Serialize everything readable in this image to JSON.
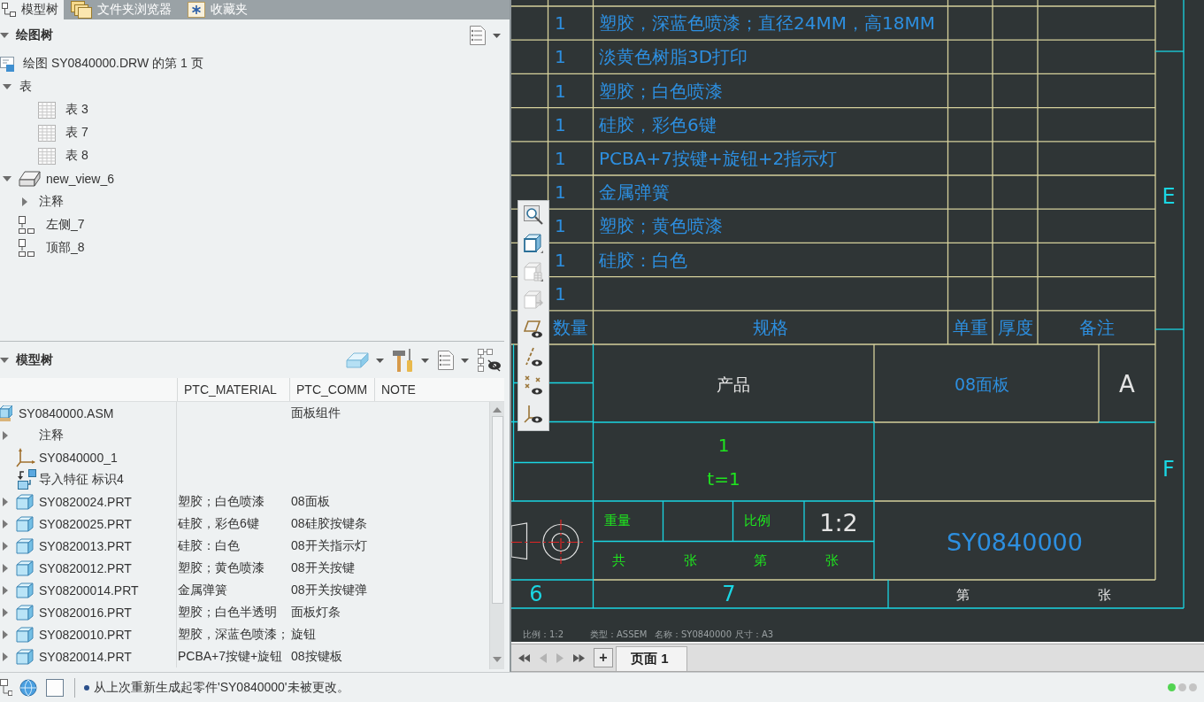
{
  "left_panel": {
    "tabs": [
      {
        "kind": "tree",
        "label": "模型树",
        "selected": true
      },
      {
        "kind": "folders",
        "label": "文件夹浏览器",
        "selected": false
      },
      {
        "kind": "favorites",
        "label": "收藏夹",
        "selected": false
      }
    ],
    "drawing_tree": {
      "title": "绘图树",
      "expanded": true,
      "items": [
        {
          "kind": "sheet",
          "label": "绘图 SY0840000.DRW 的第 1 页"
        },
        {
          "kind": "group",
          "label": "表",
          "expanded": true,
          "children": [
            {
              "kind": "table",
              "label": "表 3"
            },
            {
              "kind": "table",
              "label": "表 7"
            },
            {
              "kind": "table",
              "label": "表 8"
            }
          ]
        },
        {
          "kind": "view",
          "label": "new_view_6",
          "expanded": true,
          "children": [
            {
              "kind": "group",
              "label": "注释",
              "expanded": false
            }
          ]
        },
        {
          "kind": "projection_view",
          "label": "左侧_7"
        },
        {
          "kind": "projection_view",
          "label": "顶部_8"
        }
      ]
    },
    "model_tree": {
      "title": "模型树",
      "expanded": true,
      "columns": [
        "PTC_MATERIAL",
        "PTC_COMM",
        "NOTE"
      ],
      "root": {
        "kind": "assembly",
        "label": "SY0840000.ASM",
        "ptc_comm": "面板组件",
        "children": [
          {
            "kind": "group",
            "label": "注释",
            "expanded": false
          },
          {
            "kind": "csys",
            "label": "SY0840000_1"
          },
          {
            "kind": "import",
            "label": "导入特征 标识4"
          },
          {
            "kind": "part",
            "label": "SY0820024.PRT",
            "expanded": false,
            "ptc_material": "塑胶；白色喷漆",
            "ptc_comm": "08面板"
          },
          {
            "kind": "part",
            "label": "SY0820025.PRT",
            "expanded": false,
            "ptc_material": "硅胶，彩色6键",
            "ptc_comm": "08硅胶按键条"
          },
          {
            "kind": "part",
            "label": "SY0820013.PRT",
            "expanded": false,
            "ptc_material": "硅胶：白色",
            "ptc_comm": "08开关指示灯"
          },
          {
            "kind": "part",
            "label": "SY0820012.PRT",
            "expanded": false,
            "ptc_material": "塑胶；黄色喷漆",
            "ptc_comm": "08开关按键"
          },
          {
            "kind": "part",
            "label": "SY08200014.PRT",
            "expanded": false,
            "ptc_material": "金属弹簧",
            "ptc_comm": "08开关按键弹"
          },
          {
            "kind": "part",
            "label": "SY0820016.PRT",
            "expanded": false,
            "ptc_material": "塑胶；白色半透明",
            "ptc_comm": "面板灯条"
          },
          {
            "kind": "part",
            "label": "SY0820010.PRT",
            "expanded": false,
            "ptc_material": "塑胶，深蓝色喷漆；",
            "ptc_comm": "旋钮"
          },
          {
            "kind": "part",
            "label": "SY0820014.PRT",
            "expanded": false,
            "ptc_material": "PCBA+7按键+旋钮",
            "ptc_comm": "08按键板"
          }
        ]
      }
    }
  },
  "drawing": {
    "parts_list": {
      "columns": [
        "数量",
        "规格",
        "单重",
        "厚度",
        "备注"
      ],
      "rows": [
        {
          "qty": "1",
          "spec": "塑胶，深蓝色喷漆；直径24MM，高18MM"
        },
        {
          "qty": "1",
          "spec": "淡黄色树脂3D打印"
        },
        {
          "qty": "1",
          "spec": "塑胶；白色喷漆"
        },
        {
          "qty": "1",
          "spec": "硅胶，彩色6键"
        },
        {
          "qty": "1",
          "spec": "PCBA+7按键+旋钮+2指示灯"
        },
        {
          "qty": "1",
          "spec": "金属弹簧"
        },
        {
          "qty": "1",
          "spec": "塑胶；黄色喷漆"
        },
        {
          "qty": "1",
          "spec": "硅胶：白色"
        },
        {
          "qty": "1"
        }
      ]
    },
    "title_block": {
      "product": "产品",
      "part_name": "08面板",
      "revision": "A",
      "notes": [
        "1",
        "t=1"
      ],
      "weight_label": "重量",
      "scale_label": "比例",
      "scale": "1:2",
      "sheet_count": [
        "共",
        "张",
        "第",
        "张"
      ],
      "drawing_number": "SY0840000"
    },
    "footer": {
      "border_numbers": [
        "6",
        "7"
      ],
      "sheet": [
        "第",
        "张"
      ]
    },
    "zones": [
      "E",
      "F"
    ],
    "info_line": [
      "比例：1:2",
      "类型：ASSEM",
      "名称：SY0840000",
      "尺寸：A3"
    ]
  },
  "view_toolbar": [
    {
      "kind": "zoom",
      "disabled": false
    },
    {
      "kind": "cube",
      "disabled": false
    },
    {
      "kind": "cube_grid",
      "disabled": true
    },
    {
      "kind": "cube_arrow",
      "disabled": true
    },
    {
      "kind": "plane_eye",
      "disabled": false
    },
    {
      "kind": "axis_eye",
      "disabled": false
    },
    {
      "kind": "point_eye",
      "disabled": false
    },
    {
      "kind": "csys_eye",
      "disabled": false
    }
  ],
  "page_tabs": {
    "nav": [
      {
        "kind": "first",
        "disabled": false
      },
      {
        "kind": "prev",
        "disabled": true
      },
      {
        "kind": "next",
        "disabled": true
      },
      {
        "kind": "last",
        "disabled": false
      }
    ],
    "add_label": "+",
    "tabs": [
      {
        "label": "页面 1",
        "selected": true
      }
    ]
  },
  "status_bar": {
    "message": "从上次重新生成起零件'SY0840000'未被更改。",
    "lights": [
      {
        "color": "#52d452"
      },
      {
        "color": "#c4c4c4"
      },
      {
        "color": "#c4c4c4"
      }
    ]
  }
}
